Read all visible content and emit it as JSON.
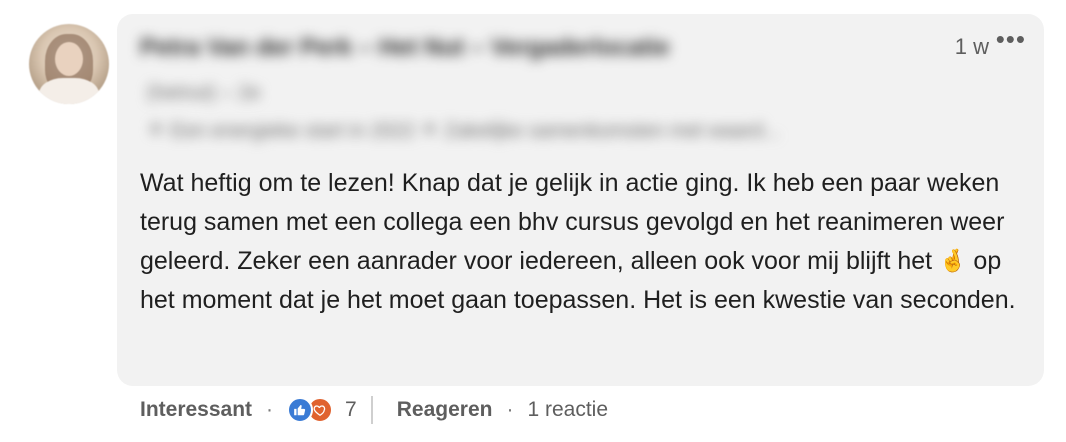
{
  "comment": {
    "author_name": "Petra Van der Perk – Het Nut – Vergaderlocatie",
    "author_subline": "(hetnut) – 2e",
    "author_headline": "⚘ Een energieke start in 2022 ⚘ Zakelijke samenkomsten met waard...",
    "timestamp": "1 w",
    "more_label": "•••",
    "text_before_emoji": "Wat heftig om te lezen! Knap dat je gelijk in actie ging. Ik heb een paar weken terug samen met een collega een bhv cursus gevolgd en het reanimeren weer geleerd. Zeker een aanrader voor iedereen, alleen ook voor mij blijft het ",
    "emoji": "🤞",
    "text_after_emoji": " op het moment dat je het moet gaan toepassen. Het is een kwestie van seconden."
  },
  "actions": {
    "react_label": "Interessant",
    "dot1": "·",
    "reaction_count": "7",
    "reply_label": "Reageren",
    "dot2": "·",
    "reply_count": "1 reactie"
  },
  "icons": {
    "like": "thumbs-up-icon",
    "love": "heart-icon",
    "more": "more-horizontal-icon"
  },
  "colors": {
    "bubble_bg": "#f2f2f2",
    "like": "#3a7bd5",
    "love": "#e0622f"
  }
}
